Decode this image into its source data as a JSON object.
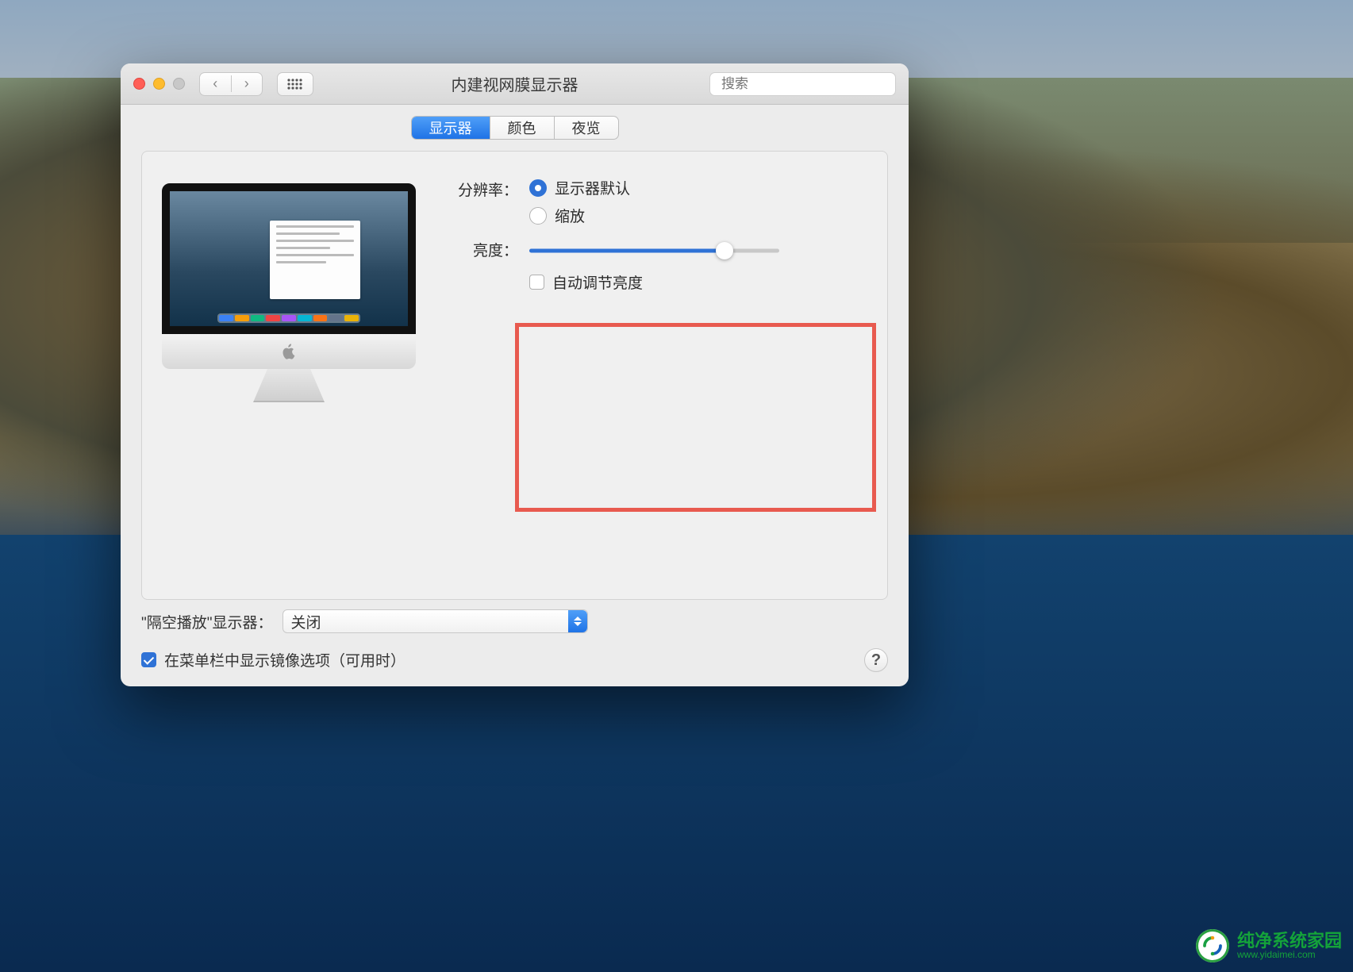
{
  "titlebar": {
    "window_title": "内建视网膜显示器",
    "search_placeholder": "搜索"
  },
  "tabs": {
    "display": "显示器",
    "color": "颜色",
    "night": "夜览"
  },
  "settings": {
    "resolution_label": "分辨率：",
    "resolution_default": "显示器默认",
    "resolution_scaled": "缩放",
    "brightness_label": "亮度：",
    "auto_brightness": "自动调节亮度"
  },
  "airplay": {
    "label": "\"隔空播放\"显示器：",
    "value": "关闭"
  },
  "mirror": {
    "label": "在菜单栏中显示镜像选项（可用时）"
  },
  "help": "?",
  "watermark": {
    "name": "纯净系统家园",
    "url": "www.yidaimei.com"
  }
}
